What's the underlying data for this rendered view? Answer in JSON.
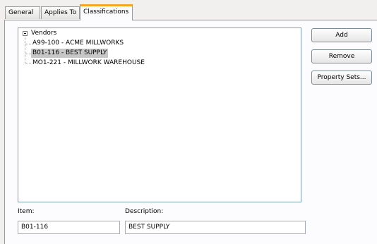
{
  "tabs": [
    {
      "label": "General"
    },
    {
      "label": "Applies To"
    },
    {
      "label": "Classifications"
    }
  ],
  "tree": {
    "root": {
      "label": "Vendors",
      "expanded": true
    },
    "children": [
      {
        "label": "A99-100 - ACME MILLWORKS",
        "selected": false
      },
      {
        "label": "B01-116 - BEST SUPPLY",
        "selected": true
      },
      {
        "label": "MO1-221 - MILLWORK WAREHOUSE",
        "selected": false
      }
    ]
  },
  "buttons": {
    "add": "Add",
    "remove": "Remove",
    "property_sets": "Property Sets..."
  },
  "fields": {
    "item_label": "Item:",
    "item_value": "B01-116",
    "description_label": "Description:",
    "description_value": "BEST SUPPLY"
  },
  "colors": {
    "active_tab_accent": "#f5a623",
    "selection": "#c7c7c7",
    "tree_border": "#7f9db9"
  }
}
